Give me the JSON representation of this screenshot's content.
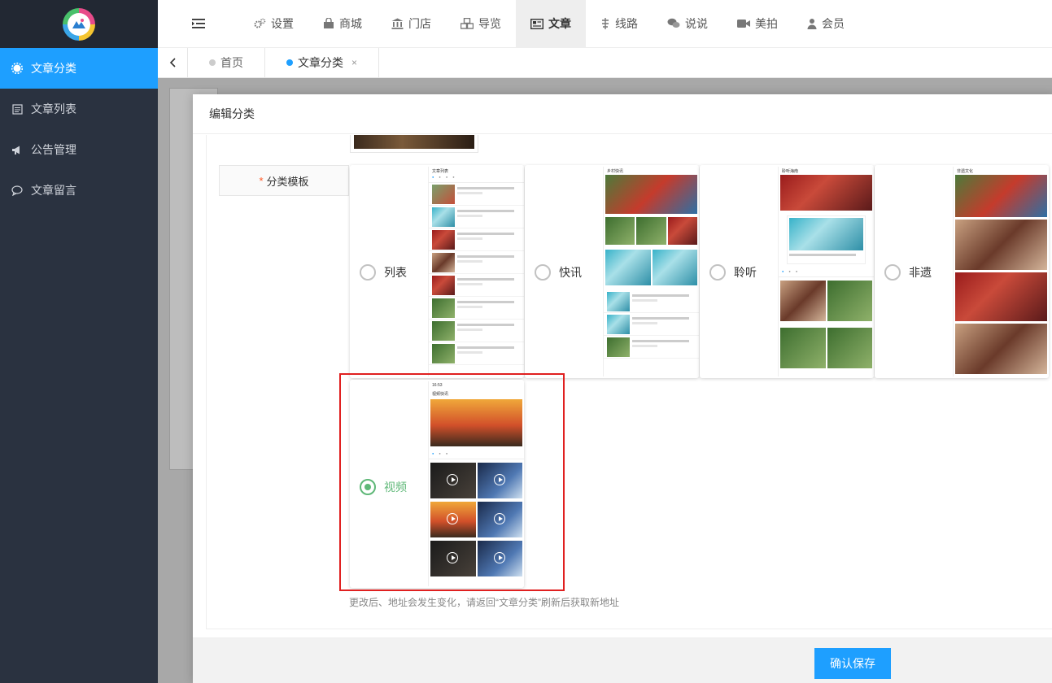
{
  "sidebar": {
    "items": [
      {
        "label": "文章分类",
        "icon": "gear-icon",
        "active": true
      },
      {
        "label": "文章列表",
        "icon": "list-icon",
        "active": false
      },
      {
        "label": "公告管理",
        "icon": "megaphone-icon",
        "active": false
      },
      {
        "label": "文章留言",
        "icon": "comment-icon",
        "active": false
      }
    ]
  },
  "topnav": {
    "items": [
      {
        "label": "设置",
        "icon": "gears-icon"
      },
      {
        "label": "商城",
        "icon": "shopping-bag-icon"
      },
      {
        "label": "门店",
        "icon": "bank-icon"
      },
      {
        "label": "导览",
        "icon": "cubes-icon"
      },
      {
        "label": "文章",
        "icon": "newspaper-icon",
        "active": true
      },
      {
        "label": "线路",
        "icon": "route-icon"
      },
      {
        "label": "说说",
        "icon": "chat-icon"
      },
      {
        "label": "美拍",
        "icon": "video-camera-icon"
      },
      {
        "label": "会员",
        "icon": "user-icon"
      }
    ]
  },
  "tabs": [
    {
      "label": "首页",
      "active": false
    },
    {
      "label": "文章分类",
      "active": true,
      "close": "×"
    }
  ],
  "modal": {
    "title": "编辑分类",
    "field_label": "分类模板",
    "required_mark": "*",
    "templates": [
      {
        "label": "列表",
        "checked": false
      },
      {
        "label": "快讯",
        "checked": false
      },
      {
        "label": "聆听",
        "checked": false
      },
      {
        "label": "非遗",
        "checked": false
      },
      {
        "label": "视频",
        "checked": true
      }
    ],
    "hint": "更改后、地址会发生变化，请返回“文章分类”刷新后获取新地址",
    "confirm_label": "确认保存"
  },
  "phones": {
    "list_title": "文章列表",
    "news_title": "乡村快讯",
    "listen_title": "聆听海南",
    "heritage_title": "非遗文化",
    "video_title": "视频快讯",
    "video_time": "16:53"
  },
  "colors": {
    "sidebar_bg": "#2a3240",
    "accent": "#1e9fff",
    "checked": "#5fb878",
    "highlight": "#e02020"
  }
}
